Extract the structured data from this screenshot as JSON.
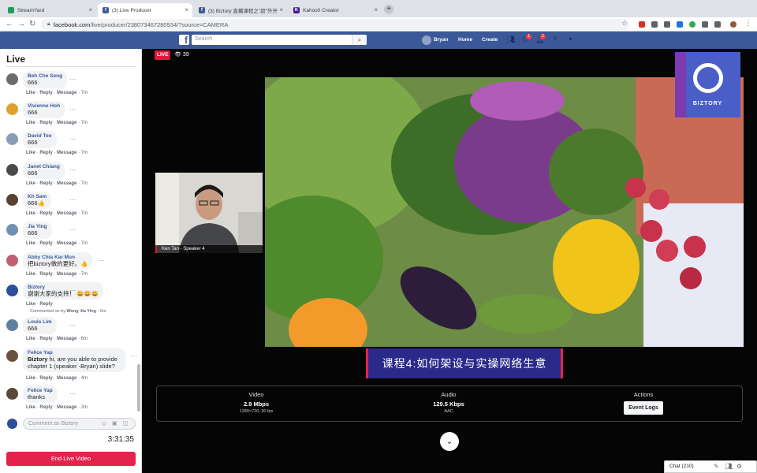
{
  "browser": {
    "tabs": [
      {
        "label": "StreamYard",
        "fav_color": "#1d9e5b"
      },
      {
        "label": "(3) Live Producer",
        "fav_color": "#3b5998"
      },
      {
        "label": "(3) Biztory 直播课程之\"超\"外开",
        "fav_color": "#3b5998"
      },
      {
        "label": "Kahoot! Creator",
        "fav_color": "#46178f"
      }
    ],
    "url_host": "facebook.com",
    "url_path": "/live/producer/238073467280934/?source=CAMERA"
  },
  "fb": {
    "search_placeholder": "Search",
    "user_name": "Bryan",
    "nav": [
      "Home",
      "Create"
    ],
    "badges": {
      "messages": "1",
      "notifications": "2"
    }
  },
  "live_panel": {
    "title": "Live",
    "comments": [
      {
        "name": "Beh Che Seng",
        "text": "666",
        "time": "7m"
      },
      {
        "name": "Vivienne Hoh",
        "text": "666",
        "time": "7m"
      },
      {
        "name": "David Teo",
        "text": "666",
        "time": "7m"
      },
      {
        "name": "Janet Chiang",
        "text": "666",
        "time": "7m"
      },
      {
        "name": "Kh Sam",
        "text": "666👍",
        "time": "7m"
      },
      {
        "name": "Jia Ying",
        "text": "666",
        "time": "7m"
      },
      {
        "name": "Abby Chia Kar Mun",
        "text": "把biztory做的更好。👍",
        "time": "7m"
      },
      {
        "name": "Biztory",
        "text": "谢谢大家的支持！ 😀😀😀",
        "time": "",
        "commented_by_prefix": "Commented on by",
        "commented_by": "Wong Jia Ying",
        "commented_time": "6m"
      },
      {
        "name": "Louis Lim",
        "text": "666",
        "time": "6m"
      },
      {
        "name": "Felice Yap",
        "mention": "Biztory",
        "text": " hi, are you able to provide chapter 1 (speaker -Bryan) slide?",
        "time": "4m"
      },
      {
        "name": "Felice Yap",
        "text": "thanks",
        "time": "2m"
      }
    ],
    "action_like": "Like",
    "action_reply": "Reply",
    "action_message": "Message",
    "compose_placeholder": "Comment as Biztory",
    "timer": "3:31:35",
    "end_button": "End Live Video"
  },
  "stream": {
    "live_label": "LIVE",
    "viewers": "39",
    "speaker_label": "Ken Tan - Speaker 4",
    "logo_text": "BIZTORY",
    "caption": "课程4:如何架设与实操网络生意",
    "video_label": "Video",
    "video_bitrate": "2.9 Mbps",
    "video_detail": "1280×720, 30 fps",
    "audio_label": "Audio",
    "audio_bitrate": "129.5 Kbps",
    "audio_detail": "AAC",
    "actions_label": "Actions",
    "event_logs": "Event Logs",
    "chat_label": "Chat (210)"
  }
}
